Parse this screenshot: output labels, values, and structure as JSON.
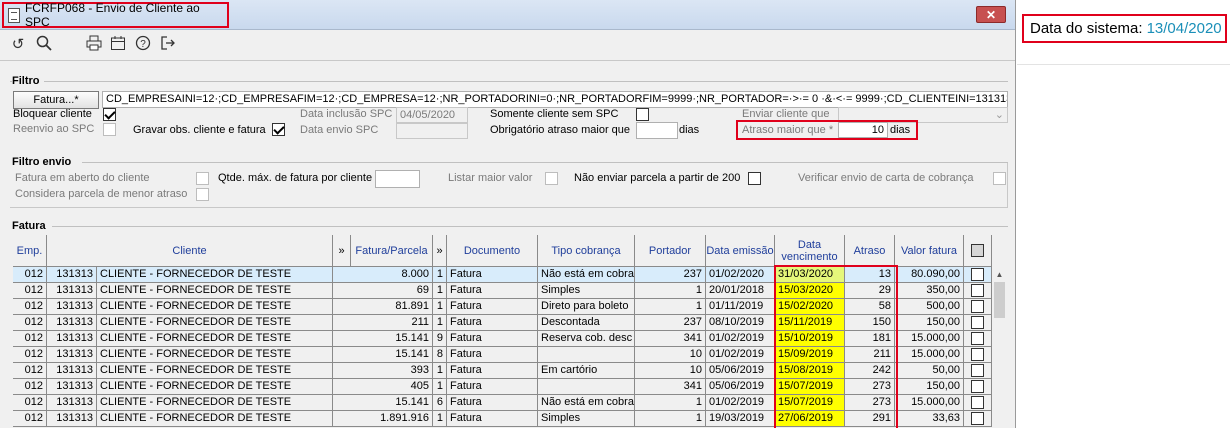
{
  "window": {
    "title": "FCRFP068 - Envio de Cliente ao SPC",
    "close_label": "✕"
  },
  "toolbar": {
    "icons": [
      "undo-icon",
      "search-icon",
      "print-icon",
      "calendar-icon",
      "help-icon",
      "exit-icon"
    ]
  },
  "filtro": {
    "title": "Filtro",
    "fatura_button": "Fatura...*",
    "fatura_value": "CD_EMPRESAINI=12·;CD_EMPRESAFIM=12·;CD_EMPRESA=12·;NR_PORTADORINI=0·;NR_PORTADORFIM=9999·;NR_PORTADOR=·>·= 0 ·&·<·= 9999·;CD_CLIENTEINI=131313·;CD_CLIENTE",
    "bloquear_cliente": "Bloquear cliente",
    "reenvio_spc": "Reenvio ao SPC",
    "gravar_obs": "Gravar obs. cliente e fatura",
    "data_inclusao_label": "Data inclusão SPC",
    "data_inclusao_value": "04/05/2020",
    "data_envio_label": "Data envio SPC",
    "somente_cliente": "Somente cliente sem SPC",
    "obrigatorio_atraso": "Obrigatório atraso maior que",
    "dias1": "dias",
    "enviar_cliente_label": "Enviar cliente que",
    "atraso_maior_label": "Atraso maior que *",
    "atraso_maior_value": "10",
    "dias2": "dias"
  },
  "filtro_envio": {
    "title": "Filtro envio",
    "fatura_aberto": "Fatura em aberto do cliente",
    "qtde_max": "Qtde. máx. de fatura por cliente",
    "listar_maior": "Listar maior valor",
    "nao_enviar": "Não enviar parcela a partir de 200",
    "verificar_envio": "Verificar envio de carta de cobrança",
    "considera_parcela": "Considera parcela de menor atraso"
  },
  "fatura": {
    "title": "Fatura",
    "columns": [
      "Emp.",
      "Cliente",
      "»",
      "Fatura/Parcela",
      "»",
      "Documento",
      "Tipo cobrança",
      "Portador",
      "Data emissão",
      "Data vencimento",
      "Atraso",
      "Valor fatura"
    ],
    "rows": [
      {
        "emp": "012",
        "cod": "131313",
        "nome": "CLIENTE - FORNECEDOR DE TESTE",
        "fatura": "8.000",
        "parcela": "1",
        "doc": "Fatura",
        "tipo": "Não está em cobrai",
        "portador": "237",
        "emissao": "01/02/2020",
        "venc": "31/03/2020",
        "atraso": "13",
        "valor": "80.090,00"
      },
      {
        "emp": "012",
        "cod": "131313",
        "nome": "CLIENTE - FORNECEDOR DE TESTE",
        "fatura": "69",
        "parcela": "1",
        "doc": "Fatura",
        "tipo": "Simples",
        "portador": "1",
        "emissao": "20/01/2018",
        "venc": "15/03/2020",
        "atraso": "29",
        "valor": "350,00"
      },
      {
        "emp": "012",
        "cod": "131313",
        "nome": "CLIENTE - FORNECEDOR DE TESTE",
        "fatura": "81.891",
        "parcela": "1",
        "doc": "Fatura",
        "tipo": "Direto para boleto",
        "portador": "1",
        "emissao": "01/11/2019",
        "venc": "15/02/2020",
        "atraso": "58",
        "valor": "500,00"
      },
      {
        "emp": "012",
        "cod": "131313",
        "nome": "CLIENTE - FORNECEDOR DE TESTE",
        "fatura": "211",
        "parcela": "1",
        "doc": "Fatura",
        "tipo": "Descontada",
        "portador": "237",
        "emissao": "08/10/2019",
        "venc": "15/11/2019",
        "atraso": "150",
        "valor": "150,00"
      },
      {
        "emp": "012",
        "cod": "131313",
        "nome": "CLIENTE - FORNECEDOR DE TESTE",
        "fatura": "15.141",
        "parcela": "9",
        "doc": "Fatura",
        "tipo": "Reserva cob. desc",
        "portador": "341",
        "emissao": "01/02/2019",
        "venc": "15/10/2019",
        "atraso": "181",
        "valor": "15.000,00"
      },
      {
        "emp": "012",
        "cod": "131313",
        "nome": "CLIENTE - FORNECEDOR DE TESTE",
        "fatura": "15.141",
        "parcela": "8",
        "doc": "Fatura",
        "tipo": "",
        "portador": "10",
        "emissao": "01/02/2019",
        "venc": "15/09/2019",
        "atraso": "211",
        "valor": "15.000,00"
      },
      {
        "emp": "012",
        "cod": "131313",
        "nome": "CLIENTE - FORNECEDOR DE TESTE",
        "fatura": "393",
        "parcela": "1",
        "doc": "Fatura",
        "tipo": "Em cartório",
        "portador": "10",
        "emissao": "05/06/2019",
        "venc": "15/08/2019",
        "atraso": "242",
        "valor": "50,00"
      },
      {
        "emp": "012",
        "cod": "131313",
        "nome": "CLIENTE - FORNECEDOR DE TESTE",
        "fatura": "405",
        "parcela": "1",
        "doc": "Fatura",
        "tipo": "",
        "portador": "341",
        "emissao": "05/06/2019",
        "venc": "15/07/2019",
        "atraso": "273",
        "valor": "150,00"
      },
      {
        "emp": "012",
        "cod": "131313",
        "nome": "CLIENTE - FORNECEDOR DE TESTE",
        "fatura": "15.141",
        "parcela": "6",
        "doc": "Fatura",
        "tipo": "Não está em cobrai",
        "portador": "1",
        "emissao": "01/02/2019",
        "venc": "15/07/2019",
        "atraso": "273",
        "valor": "15.000,00"
      },
      {
        "emp": "012",
        "cod": "131313",
        "nome": "CLIENTE - FORNECEDOR DE TESTE",
        "fatura": "1.891.916",
        "parcela": "1",
        "doc": "Fatura",
        "tipo": "Simples",
        "portador": "1",
        "emissao": "19/03/2019",
        "venc": "27/06/2019",
        "atraso": "291",
        "valor": "33,63"
      }
    ]
  },
  "sistema": {
    "label": "Data do sistema:",
    "date": "13/04/2020"
  },
  "colors": {
    "red_highlight": "#e0001b",
    "yellow_venc": "#ffff00",
    "header_text": "#1f3e9b",
    "system_date": "#1a8fb8"
  }
}
